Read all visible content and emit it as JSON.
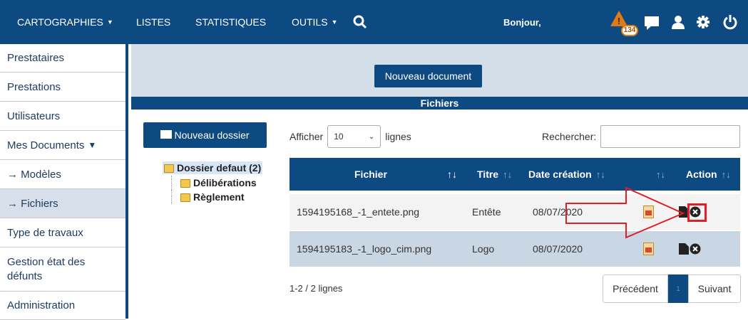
{
  "topnav": {
    "cartographies": "CARTOGRAPHIES",
    "listes": "LISTES",
    "statistiques": "STATISTIQUES",
    "outils": "OUTILS",
    "greeting": "Bonjour,",
    "alert_count": "134"
  },
  "sidebar": {
    "items": [
      {
        "label": "Prestataires"
      },
      {
        "label": "Prestations"
      },
      {
        "label": "Utilisateurs"
      },
      {
        "label": "Mes Documents"
      },
      {
        "label": "→ Modèles"
      },
      {
        "label": "→ Fichiers"
      },
      {
        "label": "Type de travaux"
      },
      {
        "label": "Gestion état des défunts"
      },
      {
        "label": "Administration"
      }
    ]
  },
  "main": {
    "new_document": "Nouveau document",
    "section_title": "Fichiers",
    "new_folder": "Nouveau dossier",
    "show_label": "Afficher",
    "show_value": "10",
    "lines_label": "lignes",
    "search_label": "Rechercher:",
    "search_value": ""
  },
  "tree": {
    "root": "Dossier defaut (2)",
    "children": [
      "Délibérations",
      "Règlement"
    ]
  },
  "table": {
    "columns": [
      "Fichier",
      "Titre",
      "Date création",
      "",
      "Action"
    ],
    "rows": [
      {
        "fichier": "1594195168_-1_entete.png",
        "titre": "Entête",
        "date": "08/07/2020"
      },
      {
        "fichier": "1594195183_-1_logo_cim.png",
        "titre": "Logo",
        "date": "08/07/2020"
      }
    ]
  },
  "footer": {
    "info": "1-2 / 2 lignes",
    "prev": "Précédent",
    "page": "1",
    "next": "Suivant"
  },
  "colors": {
    "brand": "#0e4a82",
    "banner": "#d4dee9",
    "alert": "#e07b12",
    "annotation": "#e01e25"
  }
}
